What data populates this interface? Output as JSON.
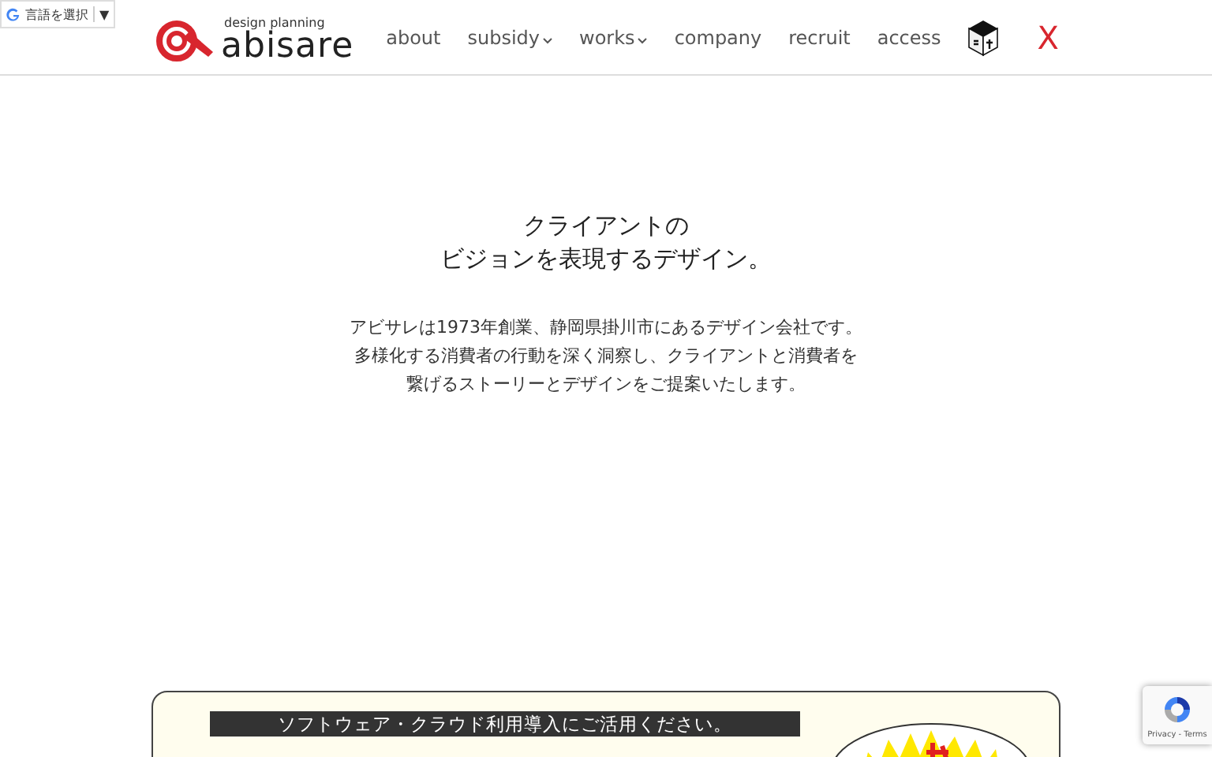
{
  "translate_widget": {
    "label": "言語を選択",
    "caret": "▼"
  },
  "logo": {
    "tagline": "design planning",
    "name": "abisare"
  },
  "nav": [
    {
      "label": "about",
      "dropdown": false
    },
    {
      "label": "subsidy",
      "dropdown": true
    },
    {
      "label": "works",
      "dropdown": true
    },
    {
      "label": "company",
      "dropdown": false
    },
    {
      "label": "recruit",
      "dropdown": false
    },
    {
      "label": "access",
      "dropdown": false
    }
  ],
  "close_button": {
    "label": "X"
  },
  "hero": {
    "heading": [
      "クライアントの",
      "ビジョンを表現するデザイン。"
    ],
    "body": [
      "アビサレは1973年創業、静岡県掛川市にあるデザイン会社です。",
      "多様化する消費者の行動を深く洞察し、クライアントと消費者を",
      "繋げるストーリーとデザインをご提案いたします。"
    ]
  },
  "banner": {
    "title": "ソフトウェア・クラウド利用導入にご活用ください。"
  },
  "recaptcha": {
    "footer": "Privacy - Terms"
  }
}
